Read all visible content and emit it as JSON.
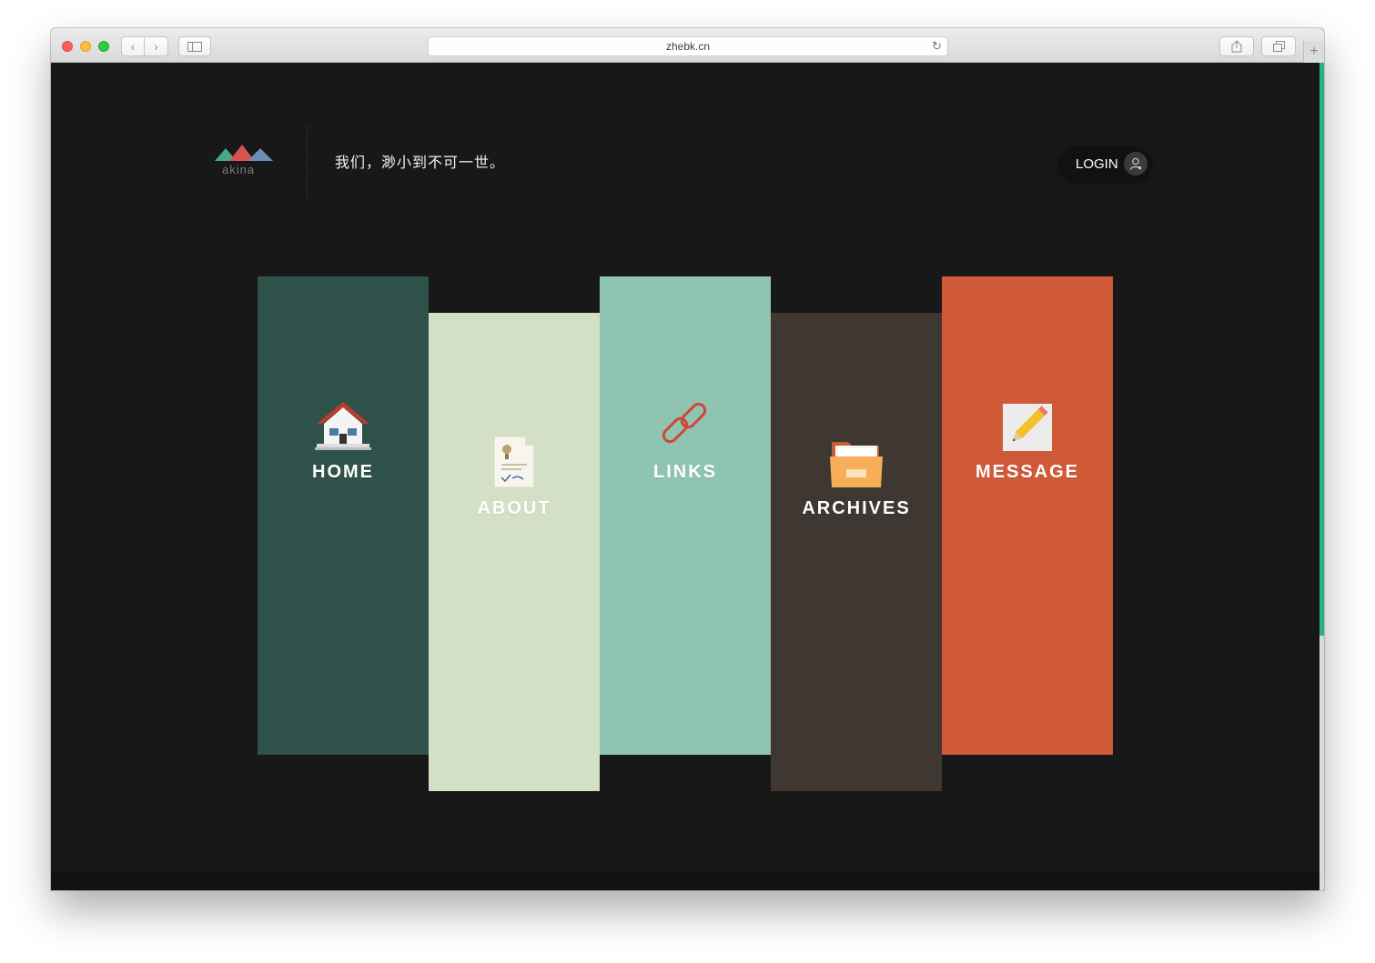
{
  "browser": {
    "url": "zhebk.cn",
    "icons": {
      "back": "chevron-left-icon",
      "forward": "chevron-right-icon",
      "sidebar": "sidebar-icon",
      "share": "share-icon",
      "tabs": "tabs-icon",
      "new_tab": "plus-icon",
      "reload": "reload-icon"
    }
  },
  "header": {
    "logo_text": "akina",
    "slogan": "我们，渺小到不可一世。",
    "login_label": "LOGIN"
  },
  "nav": {
    "cards": [
      {
        "label": "HOME",
        "color": "#2e5249",
        "icon": "house-icon"
      },
      {
        "label": "ABOUT",
        "color": "#d3e0c5",
        "icon": "document-icon"
      },
      {
        "label": "LINKS",
        "color": "#8fc4b0",
        "icon": "chain-link-icon"
      },
      {
        "label": "ARCHIVES",
        "color": "#3f3732",
        "icon": "folder-icon"
      },
      {
        "label": "MESSAGE",
        "color": "#d05a38",
        "icon": "pencil-note-icon"
      }
    ]
  },
  "theme": {
    "background": "#181818",
    "accent": "#2ab17f"
  }
}
